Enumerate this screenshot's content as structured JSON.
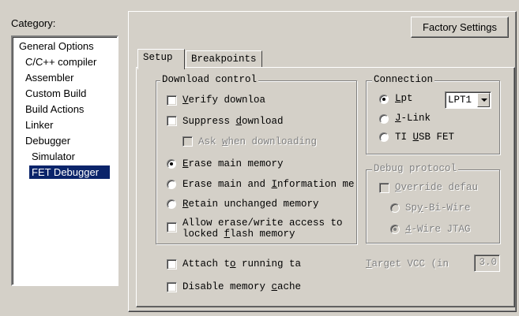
{
  "category": {
    "label": "Category:",
    "items": [
      {
        "label": "General Options"
      },
      {
        "label": "C/C++ compiler"
      },
      {
        "label": "Assembler"
      },
      {
        "label": "Custom Build"
      },
      {
        "label": "Build Actions"
      },
      {
        "label": "Linker"
      },
      {
        "label": "Debugger"
      },
      {
        "label": "Simulator"
      },
      {
        "label": "FET Debugger"
      }
    ],
    "selected": "FET Debugger"
  },
  "factory_settings_label": "Factory Settings",
  "tabs": [
    {
      "label": "Setup",
      "active": true
    },
    {
      "label": "Breakpoints",
      "active": false
    }
  ],
  "download_control": {
    "title": "Download control",
    "verify_pre": "",
    "verify_ul": "V",
    "verify_post": "erify downloa",
    "suppress_pre": "Suppress ",
    "suppress_ul": "d",
    "suppress_post": "ownload",
    "ask_pre": "Ask ",
    "ask_ul": "w",
    "ask_post": "hen downloading",
    "erase_main_pre": "",
    "erase_main_ul": "E",
    "erase_main_post": "rase main memory",
    "erase_info_pre": "Erase main and ",
    "erase_info_ul": "I",
    "erase_info_post": "nformation me",
    "retain_pre": "",
    "retain_ul": "R",
    "retain_post": "etain unchanged memory",
    "allow_line1": "Allow erase/write access to",
    "allow_line2_pre": "locked ",
    "allow_line2_ul": "f",
    "allow_line2_post": "lash memory"
  },
  "connection": {
    "title": "Connection",
    "lpt_pre": "",
    "lpt_ul": "L",
    "lpt_post": "pt",
    "lpt_port": "LPT1",
    "jlink_pre": "",
    "jlink_ul": "J",
    "jlink_post": "-Link",
    "ti_pre": "TI ",
    "ti_ul": "U",
    "ti_post": "SB FET"
  },
  "debug_protocol": {
    "title": "Debug protocol",
    "override_pre": "",
    "override_ul": "O",
    "override_post": "verride defau",
    "spy_pre": "Sp",
    "spy_ul": "y",
    "spy_post": "-Bi-Wire",
    "four_pre": "",
    "four_ul": "4",
    "four_post": "-Wire JTAG"
  },
  "attach_pre": "Attach t",
  "attach_ul": "o",
  "attach_post": " running ta",
  "target_vcc_pre": "",
  "target_vcc_ul": "T",
  "target_vcc_post": "arget VCC (in",
  "target_vcc_value": "3.0",
  "disable_cache_pre": "Disable memory ",
  "disable_cache_ul": "c",
  "disable_cache_post": "ache"
}
